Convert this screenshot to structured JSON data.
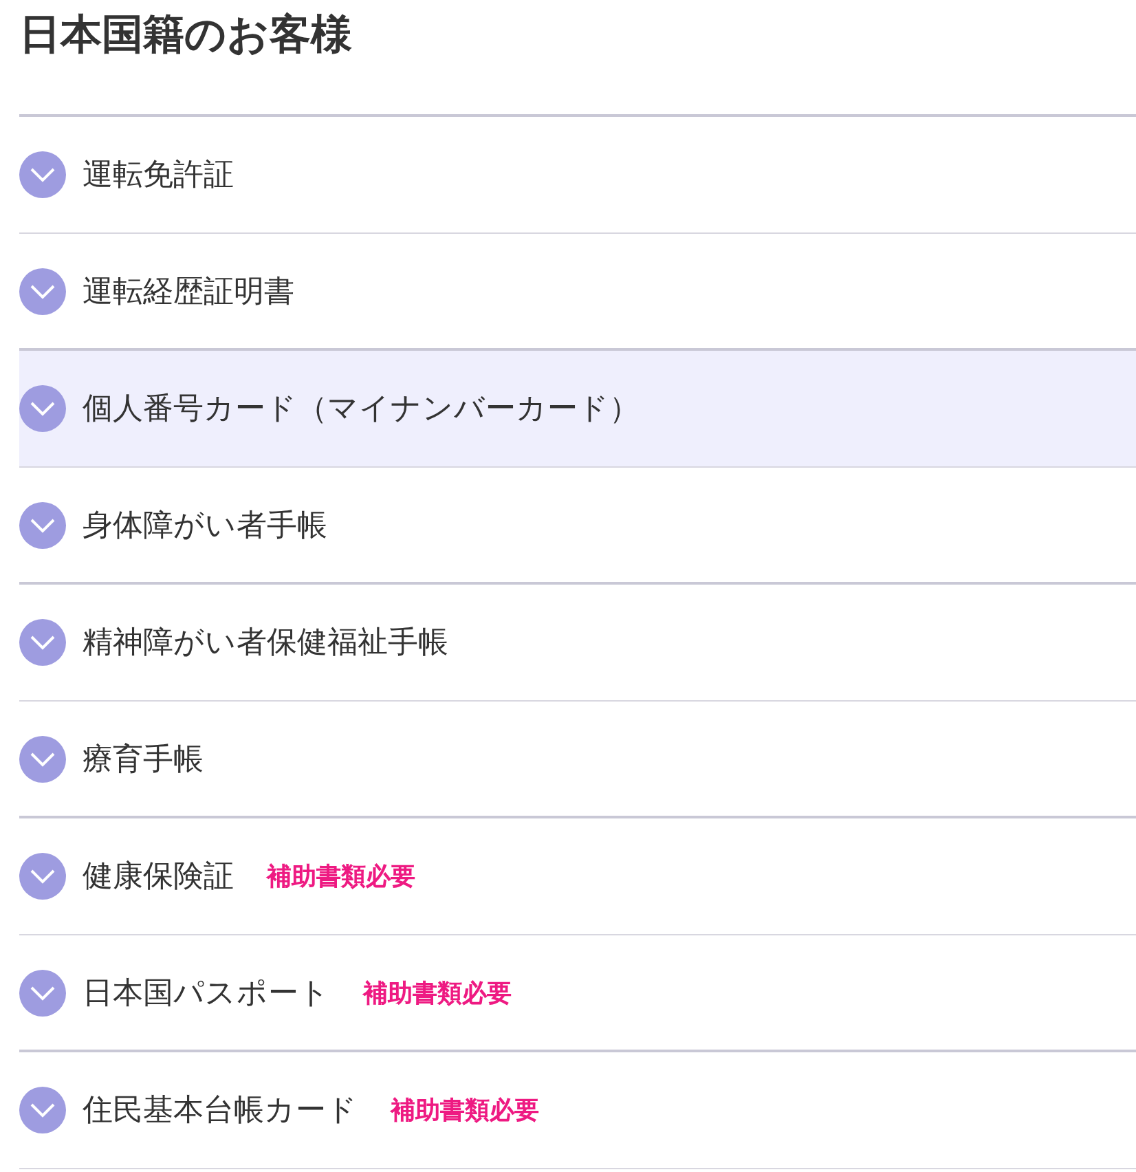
{
  "heading": "日本国籍のお客様",
  "items": [
    {
      "label": "運転免許証",
      "expanded": false,
      "highlighted": false
    },
    {
      "label": "運転経歴証明書",
      "expanded": false,
      "highlighted": false
    },
    {
      "label": "個人番号カード（マイナンバーカード）",
      "expanded": false,
      "highlighted": true
    },
    {
      "label": "身体障がい者手帳",
      "expanded": false,
      "highlighted": false
    },
    {
      "label": "精神障がい者保健福祉手帳",
      "expanded": false,
      "highlighted": false
    },
    {
      "label": "療育手帳",
      "expanded": false,
      "highlighted": false
    },
    {
      "label": "健康保険証",
      "expanded": false,
      "highlighted": false,
      "note": "補助書類必要"
    },
    {
      "label": "日本国パスポート",
      "expanded": false,
      "highlighted": false,
      "note": "補助書類必要"
    },
    {
      "label": "住民基本台帳カード",
      "expanded": false,
      "highlighted": false,
      "note": "補助書類必要"
    }
  ]
}
